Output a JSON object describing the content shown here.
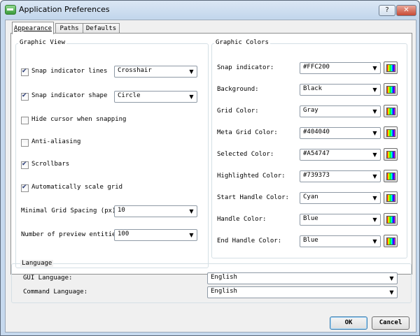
{
  "window": {
    "title": "Application Preferences",
    "help_label": "?",
    "close_label": "✕"
  },
  "tabs": [
    {
      "label": "Appearance",
      "active": true
    },
    {
      "label": "Paths",
      "active": false
    },
    {
      "label": "Defaults",
      "active": false
    }
  ],
  "graphic_view": {
    "title": "Graphic View",
    "snap_lines": {
      "label": "Snap indicator lines",
      "checked": true,
      "value": "Crosshair"
    },
    "snap_shape": {
      "label": "Snap indicator shape",
      "checked": true,
      "value": "Circle"
    },
    "hide_cursor": {
      "label": "Hide cursor when snapping",
      "checked": false
    },
    "anti_aliasing": {
      "label": "Anti-aliasing",
      "checked": false
    },
    "scrollbars": {
      "label": "Scrollbars",
      "checked": true
    },
    "auto_scale": {
      "label": "Automatically scale grid",
      "checked": true
    },
    "min_grid": {
      "label": "Minimal Grid Spacing (px):",
      "value": "10"
    },
    "preview_entities": {
      "label": "Number of preview entities:",
      "value": "100"
    }
  },
  "graphic_colors": {
    "title": "Graphic Colors",
    "rows": [
      {
        "label": "Snap indicator:",
        "value": "#FFC200"
      },
      {
        "label": "Background:",
        "value": "Black"
      },
      {
        "label": "Grid Color:",
        "value": "Gray"
      },
      {
        "label": "Meta Grid Color:",
        "value": "#404040"
      },
      {
        "label": "Selected Color:",
        "value": "#A54747"
      },
      {
        "label": "Highlighted Color:",
        "value": "#739373"
      },
      {
        "label": "Start Handle Color:",
        "value": "Cyan"
      },
      {
        "label": "Handle Color:",
        "value": "Blue"
      },
      {
        "label": "End Handle Color:",
        "value": "Blue"
      }
    ],
    "picker_icon": "color-palette-icon"
  },
  "language": {
    "title": "Language",
    "gui": {
      "label": "GUI Language:",
      "value": "English"
    },
    "command": {
      "label": "Command Language:",
      "value": "English"
    }
  },
  "buttons": {
    "ok": "OK",
    "cancel": "Cancel"
  },
  "colors": {
    "title_bar": "#c6d9ee",
    "close_button": "#c74a35",
    "check_mark": "#2b3d78"
  }
}
